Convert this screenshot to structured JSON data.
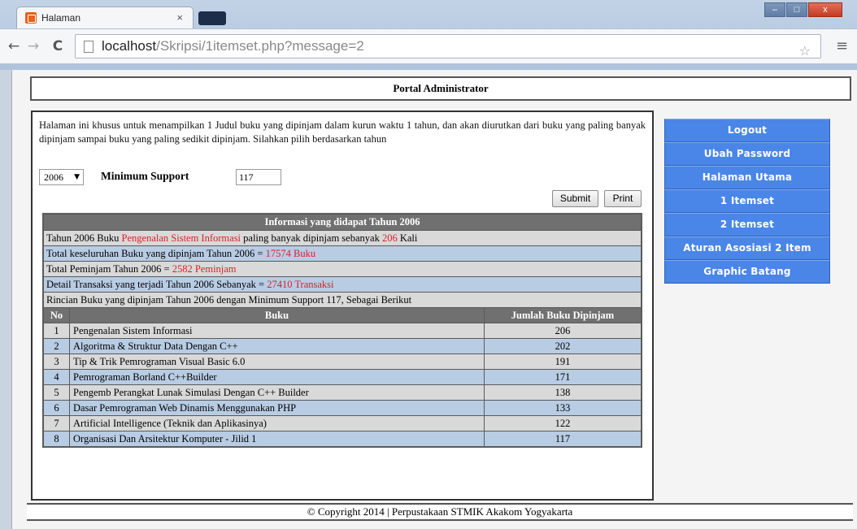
{
  "browser": {
    "tab_title": "Halaman",
    "tab_close": "×",
    "url_host": "localhost",
    "url_path": "/Skripsi/1itemset.php?message=2",
    "window_minimize": "–",
    "window_maximize": "□",
    "window_close": "x"
  },
  "page": {
    "header_title": "Portal Administrator",
    "intro_text": "Halaman ini khusus untuk menampilkan 1 Judul buku yang dipinjam dalam kurun waktu 1 tahun, dan akan diurutkan dari buku yang paling banyak dipinjam sampai buku yang paling sedikit dipinjam. Silahkan pilih berdasarkan tahun",
    "year_selected": "2006",
    "minsup_label": "Minimum Support",
    "minsup_value": "117",
    "submit_label": "Submit",
    "print_label": "Print"
  },
  "info": {
    "header": "Informasi yang didapat Tahun 2006",
    "row1": {
      "pre": "Tahun 2006 Buku ",
      "book": "Pengenalan Sistem Informasi",
      "mid": " paling banyak dipinjam sebanyak ",
      "count": "206",
      "post": " Kali"
    },
    "row2": {
      "pre": "Total keseluruhan Buku yang dipinjam Tahun 2006 = ",
      "value": "17574 Buku"
    },
    "row3": {
      "pre": "Total Peminjam Tahun 2006 = ",
      "value": "2582 Peminjam"
    },
    "row4": {
      "pre": "Detail Transaksi yang terjadi Tahun 2006 Sebanyak = ",
      "value": "27410 Transaksi"
    },
    "row5": "Rincian Buku yang dipinjam Tahun 2006 dengan Minimum Support 117, Sebagai Berikut"
  },
  "books": {
    "col_no": "No",
    "col_buku": "Buku",
    "col_jumlah": "Jumlah Buku Dipinjam",
    "rows": [
      {
        "no": "1",
        "title": "Pengenalan Sistem Informasi",
        "count": "206"
      },
      {
        "no": "2",
        "title": "Algoritma & Struktur Data Dengan C++",
        "count": "202"
      },
      {
        "no": "3",
        "title": "Tip & Trik Pemrograman Visual Basic 6.0",
        "count": "191"
      },
      {
        "no": "4",
        "title": "Pemrograman Borland C++Builder",
        "count": "171"
      },
      {
        "no": "5",
        "title": "Pengemb Perangkat Lunak Simulasi Dengan C++ Builder",
        "count": "138"
      },
      {
        "no": "6",
        "title": "Dasar Pemrograman Web Dinamis Menggunakan PHP",
        "count": "133"
      },
      {
        "no": "7",
        "title": "Artificial Intelligence (Teknik dan Aplikasinya)",
        "count": "122"
      },
      {
        "no": "8",
        "title": "Organisasi Dan Arsitektur Komputer - Jilid 1",
        "count": "117"
      }
    ]
  },
  "menu": {
    "items": [
      "Logout",
      "Ubah Password",
      "Halaman Utama",
      "1 Itemset",
      "2 Itemset",
      "Aturan Asosiasi 2 Item",
      "Graphic Batang"
    ]
  },
  "footer": "© Copyright 2014 | Perpustakaan STMIK Akakom Yogyakarta",
  "colors": {
    "menu_bg": "#4a86e8",
    "highlight_red": "#d81f2a",
    "row_gray": "#d9d9d9",
    "row_blue": "#b8cce4",
    "table_header": "#707070"
  }
}
